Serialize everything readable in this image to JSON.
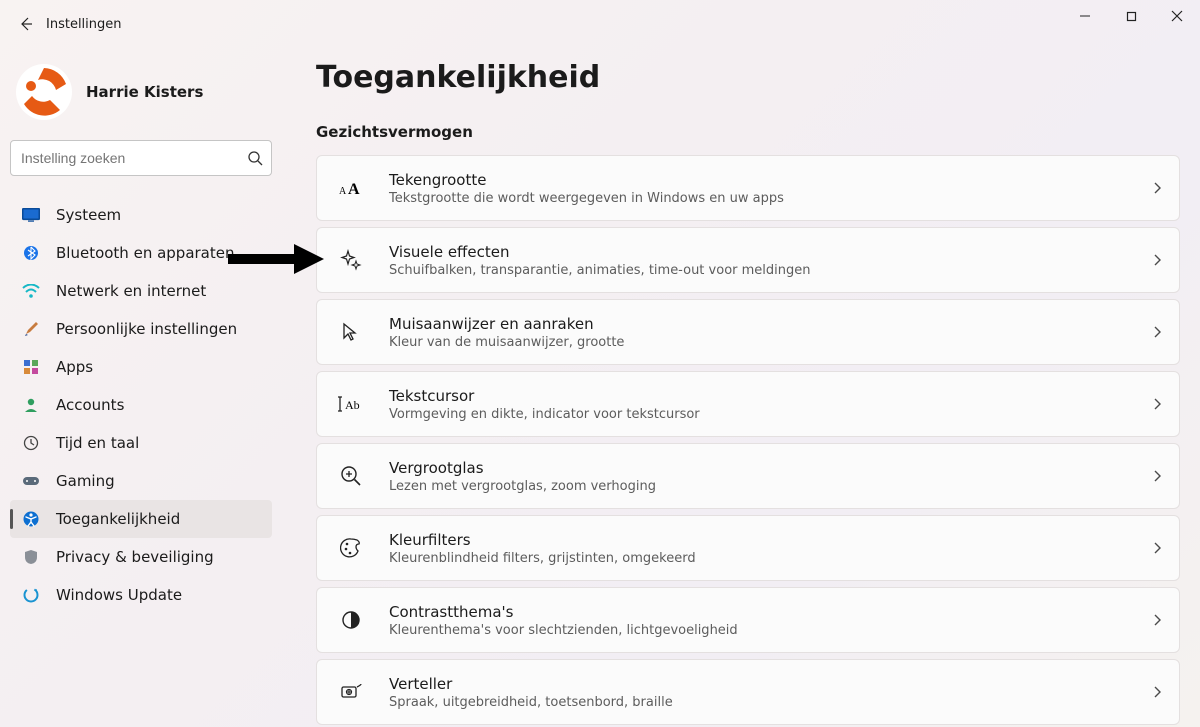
{
  "titlebar": {
    "title": "Instellingen"
  },
  "user": {
    "name": "Harrie Kisters"
  },
  "search": {
    "placeholder": "Instelling zoeken"
  },
  "nav": {
    "items": [
      {
        "label": "Systeem"
      },
      {
        "label": "Bluetooth en apparaten"
      },
      {
        "label": "Netwerk en internet"
      },
      {
        "label": "Persoonlijke instellingen"
      },
      {
        "label": "Apps"
      },
      {
        "label": "Accounts"
      },
      {
        "label": "Tijd en taal"
      },
      {
        "label": "Gaming"
      },
      {
        "label": "Toegankelijkheid"
      },
      {
        "label": "Privacy & beveiliging"
      },
      {
        "label": "Windows Update"
      }
    ],
    "active_index": 8
  },
  "main": {
    "page_title": "Toegankelijkheid",
    "section": "Gezichtsvermogen",
    "cards": [
      {
        "title": "Tekengrootte",
        "sub": "Tekstgrootte die wordt weergegeven in Windows en uw apps"
      },
      {
        "title": "Visuele effecten",
        "sub": "Schuifbalken, transparantie, animaties, time-out voor meldingen"
      },
      {
        "title": "Muisaanwijzer en aanraken",
        "sub": "Kleur van de muisaanwijzer, grootte"
      },
      {
        "title": "Tekstcursor",
        "sub": "Vormgeving en dikte, indicator voor tekstcursor"
      },
      {
        "title": "Vergrootglas",
        "sub": "Lezen met vergrootglas, zoom verhoging"
      },
      {
        "title": "Kleurfilters",
        "sub": "Kleurenblindheid filters, grijstinten, omgekeerd"
      },
      {
        "title": "Contrastthema's",
        "sub": "Kleurenthema's voor slechtzienden, lichtgevoeligheid"
      },
      {
        "title": "Verteller",
        "sub": "Spraak, uitgebreidheid, toetsenbord, braille"
      }
    ]
  }
}
